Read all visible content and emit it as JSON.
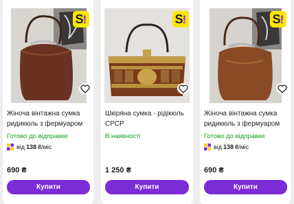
{
  "colors": {
    "accent": "#7b2cd6",
    "status_green": "#19a01e",
    "badge_yellow": "#ffe600"
  },
  "products": [
    {
      "title": "Жіноча вінтажна сумка ридикюль з фермуаром Темно-",
      "status": "Готово до відправки",
      "installment_prefix": "від",
      "installment_amount": "138",
      "installment_suffix": "₴/міс",
      "price": "690 ₴",
      "buy_label": "Купити",
      "badge": "S!"
    },
    {
      "title": "Шкіряна сумка - рідікюль СРСР",
      "status": "В наявності",
      "price": "1 250 ₴",
      "buy_label": "Купити",
      "badge": "S!"
    },
    {
      "title": "Жіноча вінтажна сумка ридикюль з фермуаром Кори-",
      "status": "Готово до відправки",
      "installment_prefix": "від",
      "installment_amount": "138",
      "installment_suffix": "₴/міс",
      "price": "690 ₴",
      "buy_label": "Купити",
      "badge": "S!"
    }
  ]
}
